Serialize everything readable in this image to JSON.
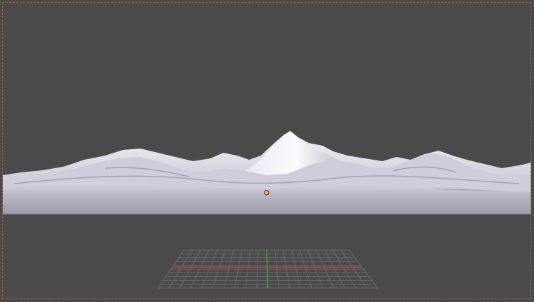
{
  "viewport": {
    "mode": "camera-view",
    "background_color": "#4a4a4a",
    "frame_border_color": "#c84a4a"
  },
  "scene": {
    "terrain": {
      "object": "landscape-mesh",
      "base_color": "#c9c7d4",
      "shade_color": "#8d8b99",
      "highlight_color": "#f2f1f7"
    },
    "origin_marker": {
      "color": "#f0b060"
    },
    "floor_grid": {
      "line_color": "#6a6a6a",
      "x_axis_color": "#b04050",
      "y_axis_color": "#40a050"
    }
  }
}
